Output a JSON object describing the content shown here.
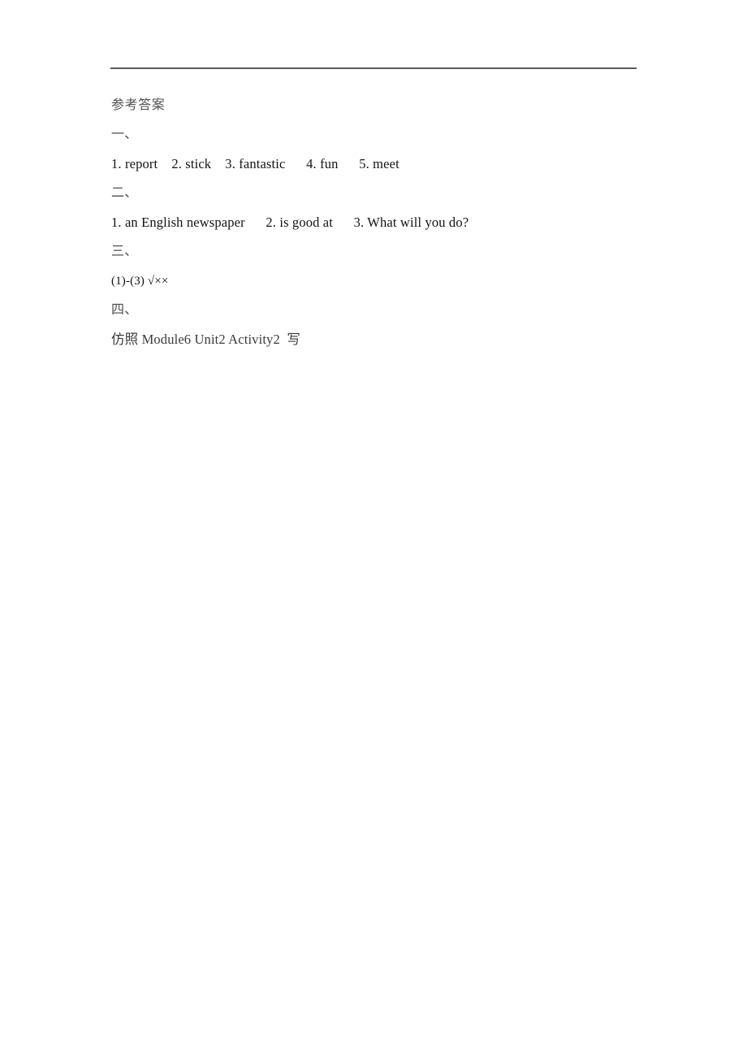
{
  "document": {
    "title": "参考答案",
    "divider": {
      "color": "#5a5a5a",
      "thickness_px": 2
    },
    "text_color": "#131313",
    "heading_color": "#4f4f4f",
    "background": "#ffffff"
  },
  "sections": [
    {
      "marker": "一、",
      "answers": "1. report    2. stick    3. fantastic      4. fun      5. meet"
    },
    {
      "marker": "二、",
      "answers": "1. an English newspaper      2. is good at      3. What will you do?"
    },
    {
      "marker": "三、",
      "answers": "(1)-(3) √××"
    },
    {
      "marker": "四、",
      "answers": "仿照 Module6 Unit2 Activity2  写"
    }
  ]
}
